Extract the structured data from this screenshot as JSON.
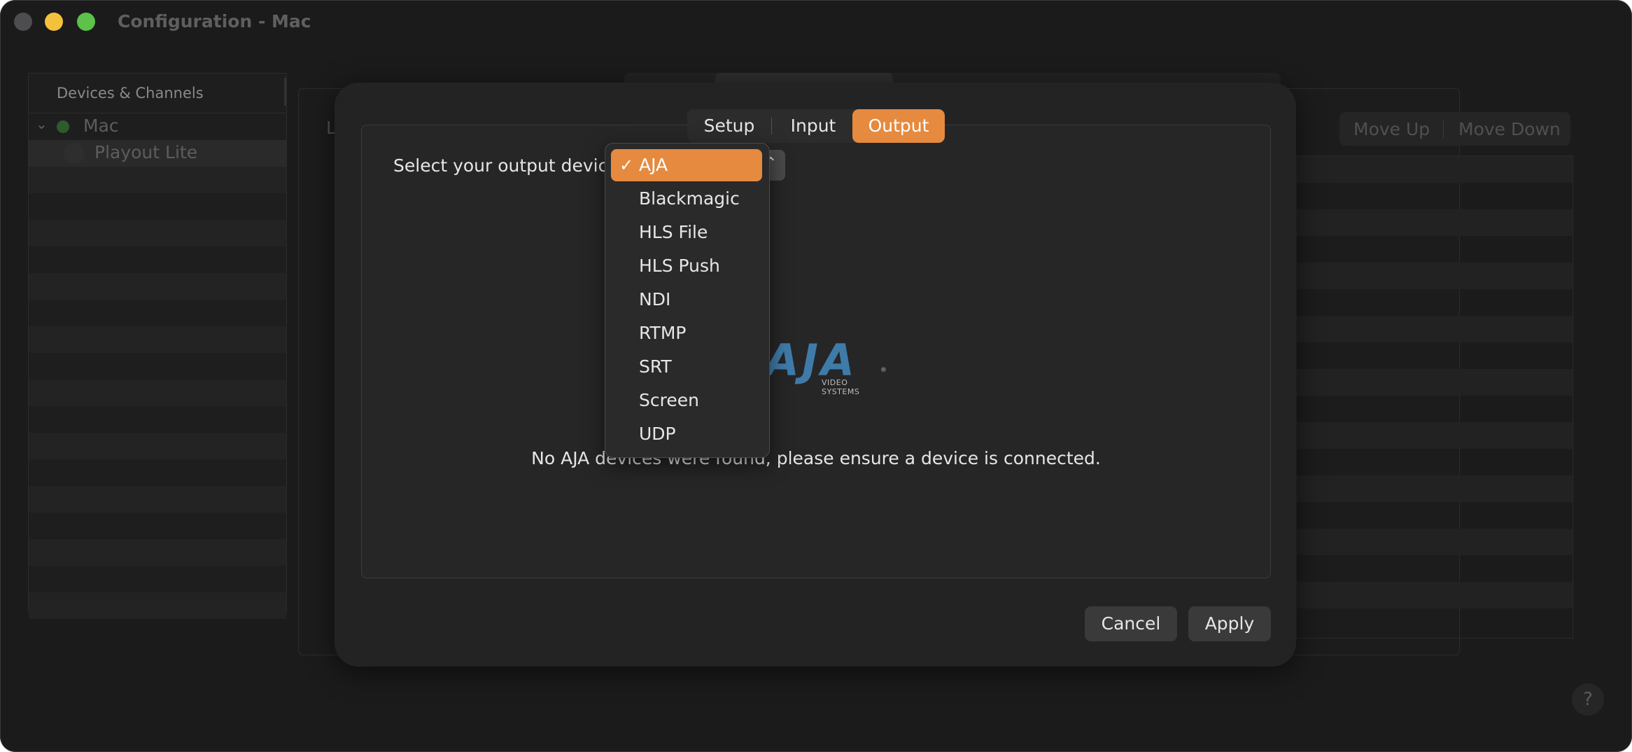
{
  "window": {
    "title": "Configuration - Mac"
  },
  "sidebar": {
    "header": "Devices & Channels",
    "device": {
      "name": "Mac",
      "status_color": "#2f5a2e"
    },
    "channel": {
      "name": "Playout Lite"
    }
  },
  "background": {
    "partial_label": "L",
    "move_up": "Move Up",
    "move_down": "Move Down"
  },
  "dialog": {
    "tabs": [
      {
        "label": "Setup",
        "selected": false
      },
      {
        "label": "Input",
        "selected": false
      },
      {
        "label": "Output",
        "selected": true
      }
    ],
    "select_label": "Select your output device:",
    "popup_glyph": "⌃",
    "menu": {
      "selected_index": 0,
      "items": [
        "AJA",
        "Blackmagic",
        "HLS File",
        "HLS Push",
        "NDI",
        "RTMP",
        "SRT",
        "Screen",
        "UDP"
      ]
    },
    "logo": {
      "word": "AJA",
      "subtitle": "VIDEO SYSTEMS",
      "registered": "®"
    },
    "message": "No AJA devices were found, please ensure a device is connected.",
    "cancel_label": "Cancel",
    "apply_label": "Apply"
  },
  "help_label": "?",
  "colors": {
    "accent": "#e58a3f",
    "background": "#1b1b1c",
    "logo_blue": "#3f7ba8"
  }
}
